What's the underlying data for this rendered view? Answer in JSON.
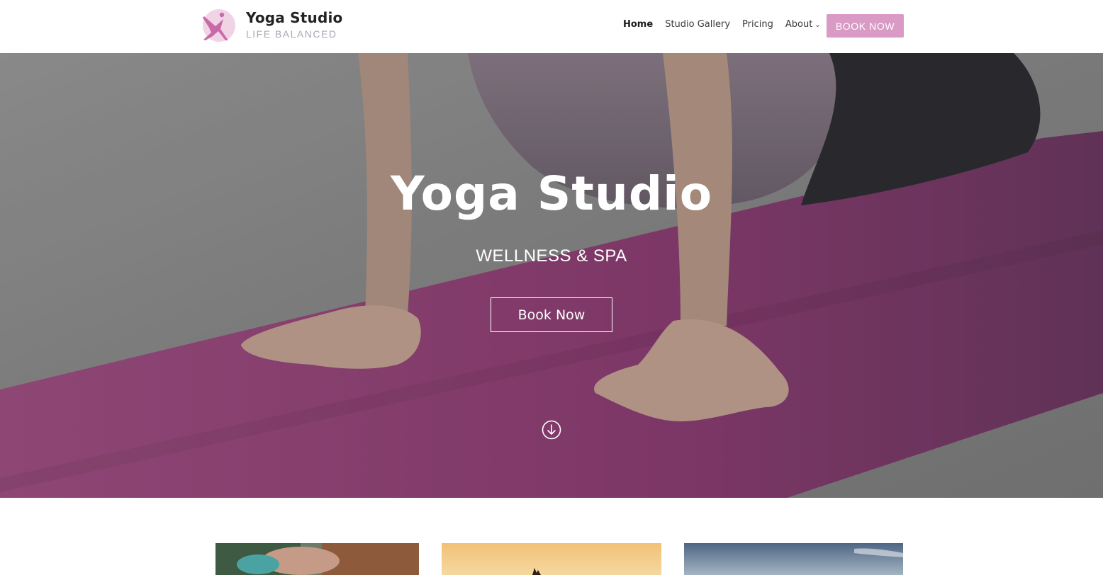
{
  "header": {
    "brand_title": "Yoga Studio",
    "brand_tagline": "LIFE BALANCED",
    "logo_icon": "yoga-pose-icon",
    "nav": [
      {
        "label": "Home",
        "active": true
      },
      {
        "label": "Studio Gallery",
        "active": false
      },
      {
        "label": "Pricing",
        "active": false
      },
      {
        "label": "About",
        "active": false,
        "has_dropdown": true
      }
    ],
    "cta_label": "BOOK NOW"
  },
  "hero": {
    "title": "Yoga Studio",
    "subtitle": "WELLNESS & SPA",
    "button_label": "Book Now",
    "scroll_icon": "arrow-down-circle-icon"
  },
  "colors": {
    "accent": "#d99ac6",
    "mat": "#b0508f",
    "text_dark": "#222222",
    "tagline": "#a8a8b4"
  }
}
